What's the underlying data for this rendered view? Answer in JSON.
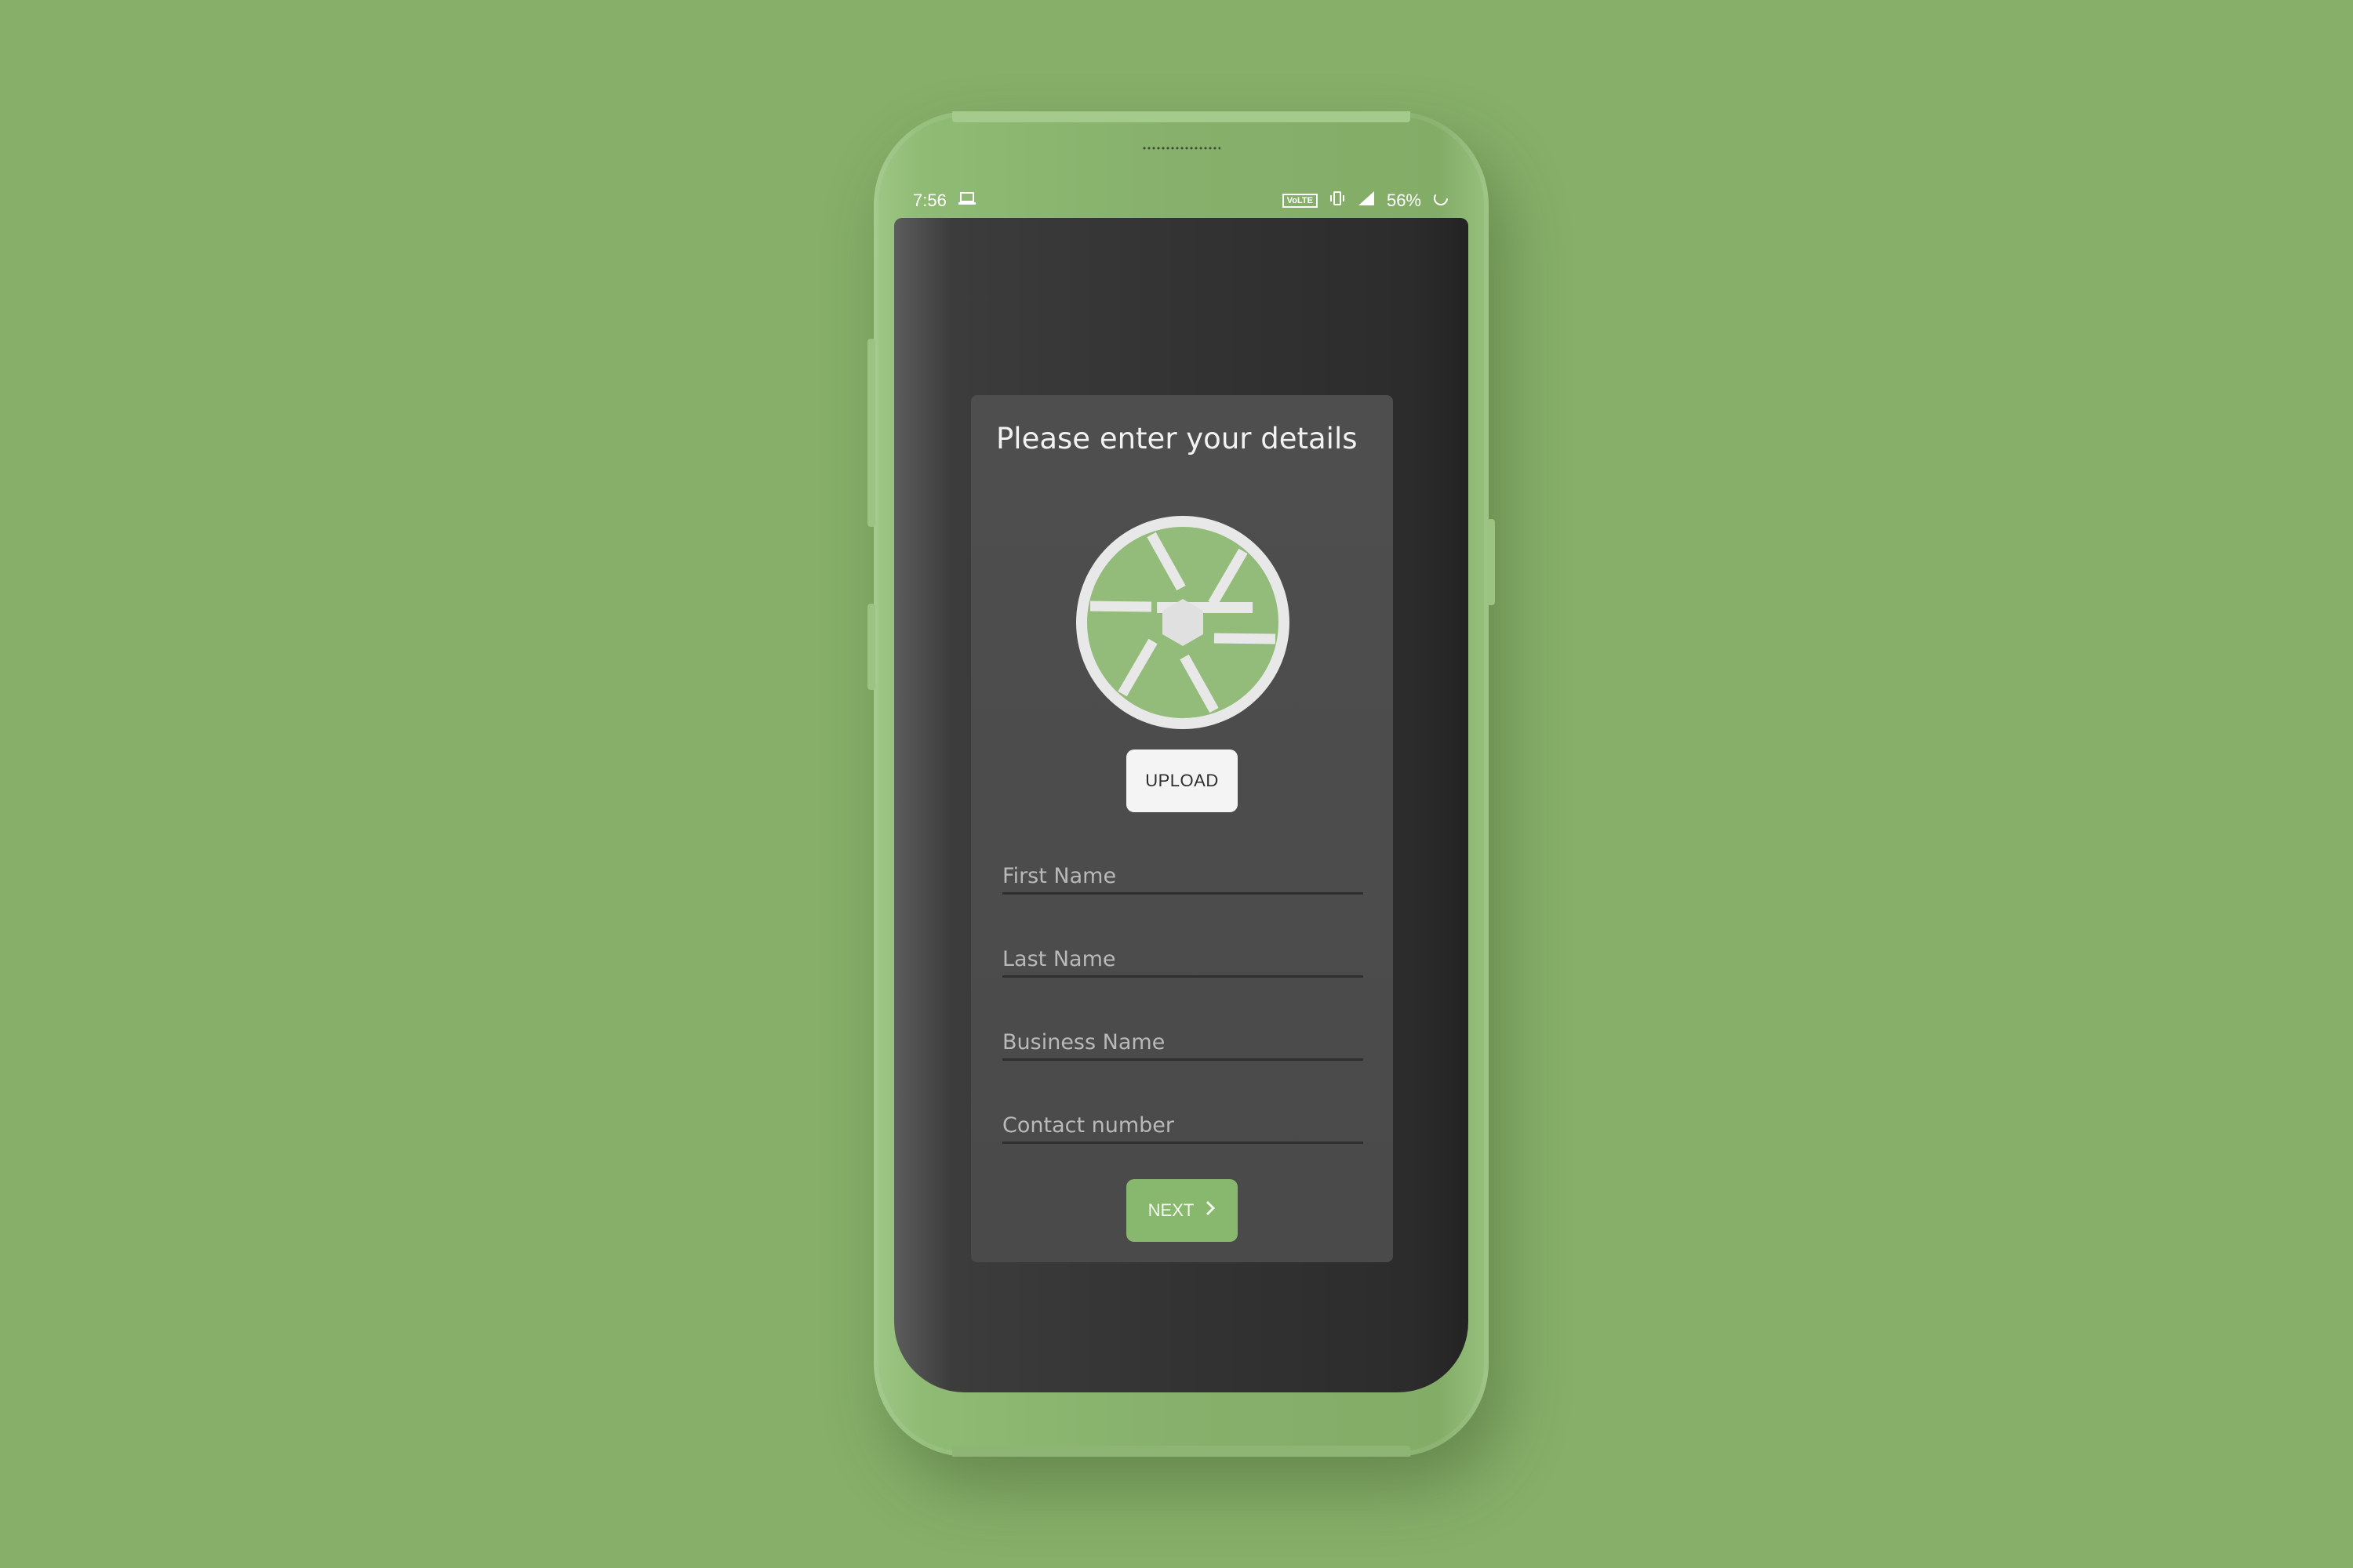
{
  "status_bar": {
    "time": "7:56",
    "network_badge": "VoLTE",
    "battery": "56%",
    "icons": [
      "laptop-icon",
      "vibrate-icon",
      "signal-icon",
      "battery-icon"
    ]
  },
  "form": {
    "title": "Please enter your details",
    "avatar_icon": "camera-aperture-icon",
    "upload_label": "UPLOAD",
    "fields": [
      {
        "placeholder": "First Name"
      },
      {
        "placeholder": "Last Name"
      },
      {
        "placeholder": "Business Name"
      },
      {
        "placeholder": "Contact number"
      }
    ],
    "next_label": "NEXT",
    "next_icon": "chevron-right-icon"
  },
  "colors": {
    "background": "#87af69",
    "accent": "#88b86d",
    "card": "#4e4e4e",
    "screen": "#333333"
  }
}
